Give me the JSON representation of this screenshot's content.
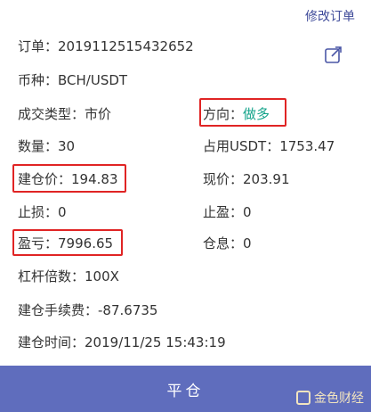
{
  "header": {
    "edit_order": "修改订单"
  },
  "share_icon": "share-icon",
  "fields": {
    "order_label": "订单：",
    "order_value": "2019112515432652",
    "coin_label": "币种：",
    "coin_value": "BCH/USDT",
    "trade_type_label": "成交类型：",
    "trade_type_value": "市价",
    "direction_label": "方向：",
    "direction_value": "做多",
    "quantity_label": "数量：",
    "quantity_value": "30",
    "usdt_used_label": "占用USDT：",
    "usdt_used_value": "1753.47",
    "open_price_label": "建仓价：",
    "open_price_value": "194.83",
    "current_price_label": "现价：",
    "current_price_value": "203.91",
    "stop_loss_label": "止损：",
    "stop_loss_value": "0",
    "take_profit_label": "止盈：",
    "take_profit_value": "0",
    "pnl_label": "盈亏：",
    "pnl_value": "7996.65",
    "position_interest_label": "仓息：",
    "position_interest_value": "0",
    "leverage_label": "杠杆倍数：",
    "leverage_value": "100X",
    "open_fee_label": "建仓手续费：",
    "open_fee_value": "-87.6735",
    "open_time_label": "建仓时间：",
    "open_time_value": "2019/11/25 15:43:19"
  },
  "footer": {
    "close_button": "平仓"
  },
  "watermark": {
    "text": "金色财经"
  },
  "colors": {
    "accent": "#5f6dbd",
    "long": "#13a38a",
    "highlight": "#e02424"
  }
}
